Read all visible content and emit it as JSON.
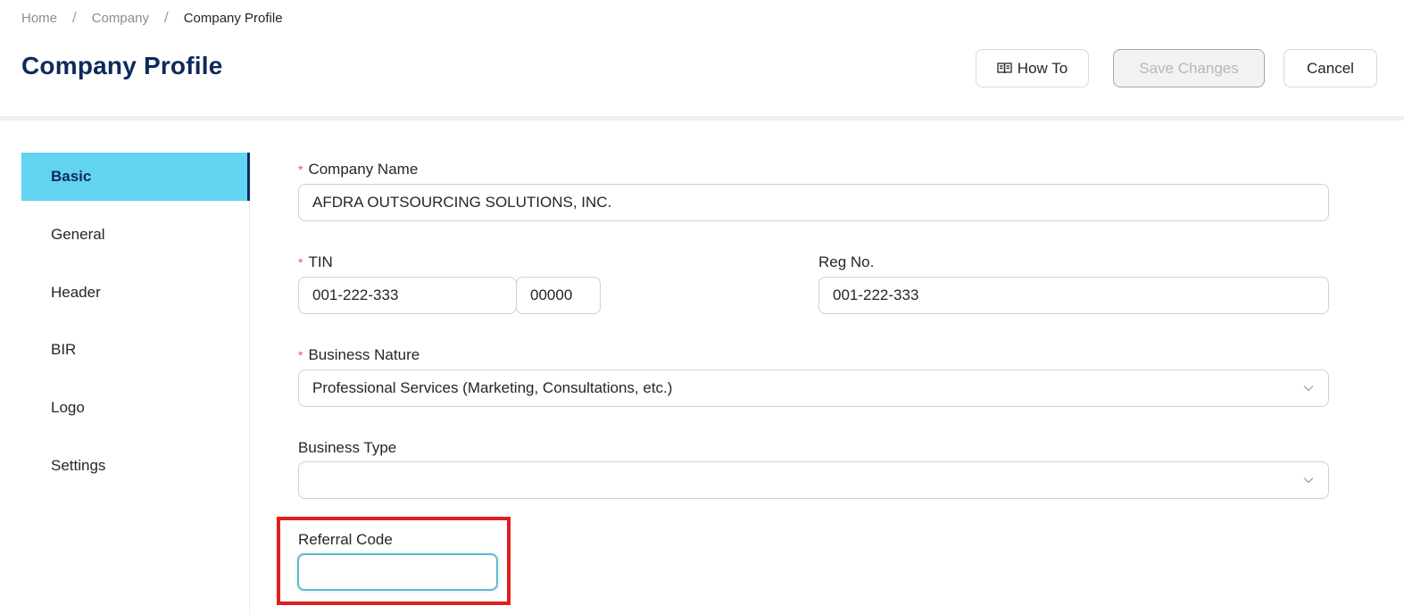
{
  "breadcrumb": {
    "items": [
      "Home",
      "Company",
      "Company Profile"
    ],
    "separator": "/"
  },
  "page": {
    "title": "Company Profile"
  },
  "actions": {
    "how_to": "How To",
    "save": "Save Changes",
    "cancel": "Cancel"
  },
  "sidebar": {
    "items": [
      "Basic",
      "General",
      "Header",
      "BIR",
      "Logo",
      "Settings"
    ],
    "active": "Basic"
  },
  "form": {
    "required_mark": "*",
    "company_name": {
      "label": "Company Name",
      "value": "AFDRA OUTSOURCING SOLUTIONS, INC."
    },
    "tin": {
      "label": "TIN",
      "value": "001-222-333",
      "branch": "00000"
    },
    "reg_no": {
      "label": "Reg No.",
      "value": "001-222-333"
    },
    "business_nature": {
      "label": "Business Nature",
      "value": "Professional Services (Marketing, Consultations, etc.)"
    },
    "business_type": {
      "label": "Business Type",
      "value": ""
    },
    "referral_code": {
      "label": "Referral Code",
      "value": ""
    }
  },
  "colors": {
    "accent": "#63d3f2",
    "title": "#0d2a5c",
    "required": "#ff4d4f",
    "highlight": "#e01e1e"
  },
  "icons": {
    "how_to": "book-icon",
    "select": "chevron-down-icon"
  }
}
